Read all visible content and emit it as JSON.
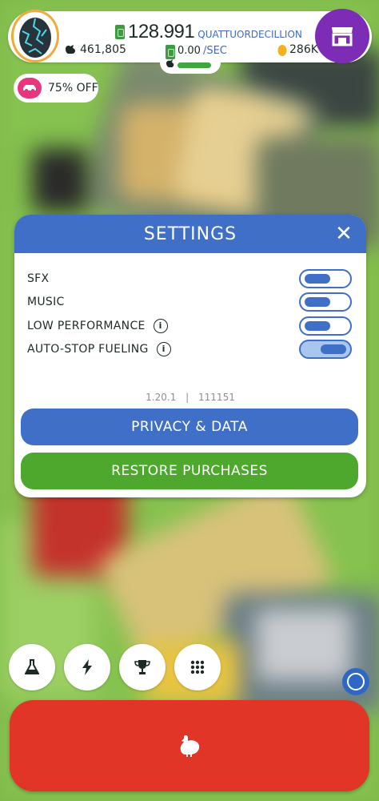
{
  "hud": {
    "money_value": "128.991",
    "money_unit": "QUATTUORDECILLION",
    "chickens": "461,805",
    "rate_value": "0.00",
    "rate_unit": "/SEC",
    "eggs": "286K"
  },
  "promo": {
    "label": "75% OFF"
  },
  "settings": {
    "title": "SETTINGS",
    "rows": [
      {
        "label": "SFX",
        "enabled": false,
        "has_info": false
      },
      {
        "label": "MUSIC",
        "enabled": false,
        "has_info": false
      },
      {
        "label": "LOW PERFORMANCE",
        "enabled": false,
        "has_info": true
      },
      {
        "label": "AUTO-STOP FUELING",
        "enabled": true,
        "has_info": true
      }
    ],
    "version": "1.20.1",
    "build": "111151",
    "privacy_button": "PRIVACY & DATA",
    "restore_button": "RESTORE PURCHASES"
  },
  "bottom_buttons": [
    "flask-icon",
    "lightning-icon",
    "trophy-icon",
    "grid-icon"
  ],
  "colors": {
    "primary_blue": "#3f6fc6",
    "green": "#4fa82e",
    "red": "#e03527",
    "shop_purple": "#7d2db5",
    "promo_pink": "#e8357d"
  }
}
